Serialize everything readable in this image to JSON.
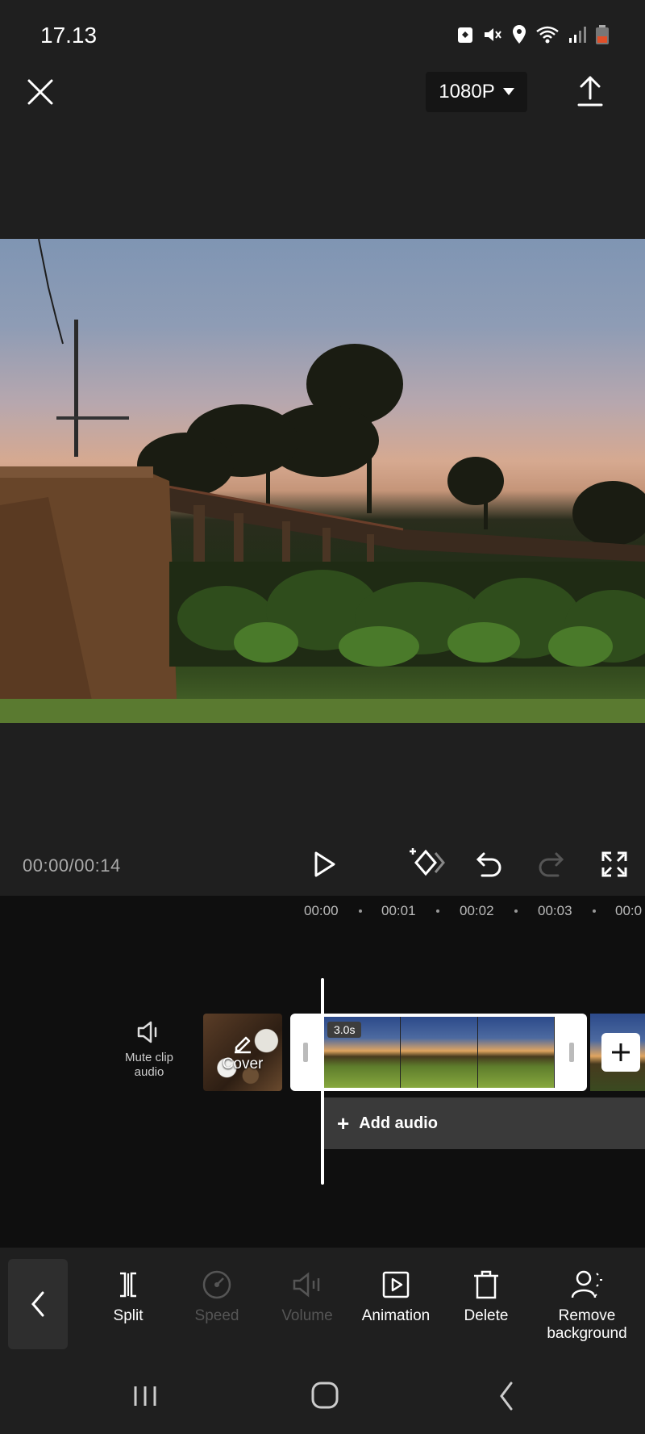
{
  "status": {
    "time": "17.13",
    "icons": [
      "nfc-icon",
      "mute-icon",
      "location-icon",
      "wifi-icon",
      "signal-icon",
      "battery-icon"
    ]
  },
  "topbar": {
    "resolution": "1080P",
    "close_icon": "close-icon",
    "export_icon": "export-icon"
  },
  "player": {
    "timecode": "00:00/00:14"
  },
  "ruler": {
    "labels": [
      "00:00",
      "00:01",
      "00:02",
      "00:03",
      "00:0"
    ]
  },
  "tracks": {
    "mute_label_1": "Mute clip",
    "mute_label_2": "audio",
    "cover_label": "Cover",
    "clip_duration": "3.0s",
    "add_audio_label": "Add audio"
  },
  "toolbar": {
    "items": [
      {
        "label": "Split",
        "enabled": true
      },
      {
        "label": "Speed",
        "enabled": false
      },
      {
        "label": "Volume",
        "enabled": false
      },
      {
        "label": "Animation",
        "enabled": true
      },
      {
        "label": "Delete",
        "enabled": true
      },
      {
        "label": "Remove",
        "label2": "background",
        "enabled": true
      }
    ]
  },
  "colors": {
    "background": "#1f1f1f",
    "timeline": "#0f0f0f",
    "disabled": "#555555"
  }
}
